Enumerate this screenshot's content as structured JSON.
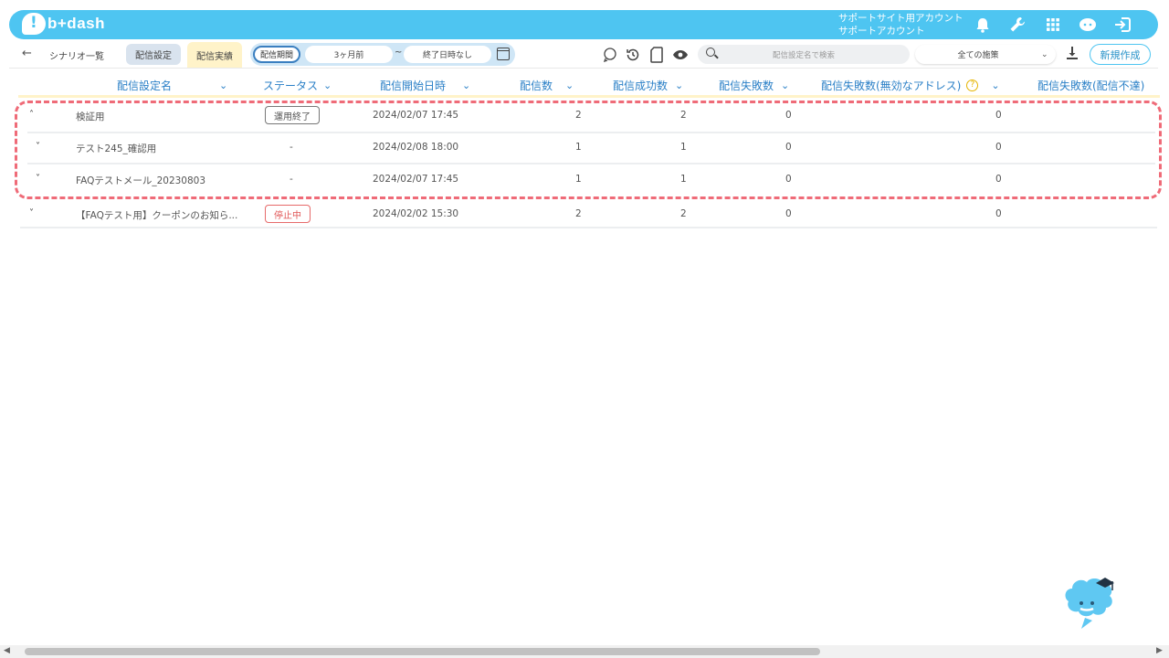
{
  "header": {
    "logo_text": "b+dash",
    "account_line1": "サポートサイト用アカウント",
    "account_line2": "サポートアカウント",
    "icons": [
      "bell-icon",
      "wrench-icon",
      "grid-icon",
      "bot-icon",
      "logout-icon"
    ],
    "bg_color": "#4ec5f1"
  },
  "toolbar": {
    "back_arrow": "←",
    "breadcrumb": "シナリオ一覧",
    "tab_settings": "配信設定",
    "tab_results": "配信実績",
    "period_label": "配信期間",
    "period_from": "3ヶ月前",
    "period_tilde": "~",
    "period_to": "終了日時なし",
    "search_placeholder": "配信設定名で検索",
    "measures_select": "全ての施策",
    "new_button": "新規作成"
  },
  "table": {
    "columns": [
      "配信設定名",
      "ステータス",
      "配信開始日時",
      "配信数",
      "配信成功数",
      "配信失敗数",
      "配信失敗数(無効なアドレス)",
      "配信失敗数(配信不達)"
    ],
    "rows": [
      {
        "toggle": "˄",
        "name": "検証用",
        "status": "運用終了",
        "start": "2024/02/07 17:45",
        "sent": "2",
        "success": "2",
        "failed": "0",
        "invalid": "0"
      },
      {
        "toggle": "˅",
        "name": "テスト245_確認用",
        "status": "-",
        "start": "2024/02/08 18:00",
        "sent": "1",
        "success": "1",
        "failed": "0",
        "invalid": "0"
      },
      {
        "toggle": "˅",
        "name": "FAQテストメール_20230803",
        "status": "-",
        "start": "2024/02/07 17:45",
        "sent": "1",
        "success": "1",
        "failed": "0",
        "invalid": "0"
      },
      {
        "toggle": "˅",
        "name": "【FAQテスト用】クーポンのお知ら...",
        "status": "停止中",
        "start": "2024/02/02 15:30",
        "sent": "2",
        "success": "2",
        "failed": "0",
        "invalid": "0"
      }
    ]
  },
  "colors": {
    "highlight": "#ef6b78",
    "header_text": "#2b80c7",
    "status_stopped": "#e05555"
  }
}
